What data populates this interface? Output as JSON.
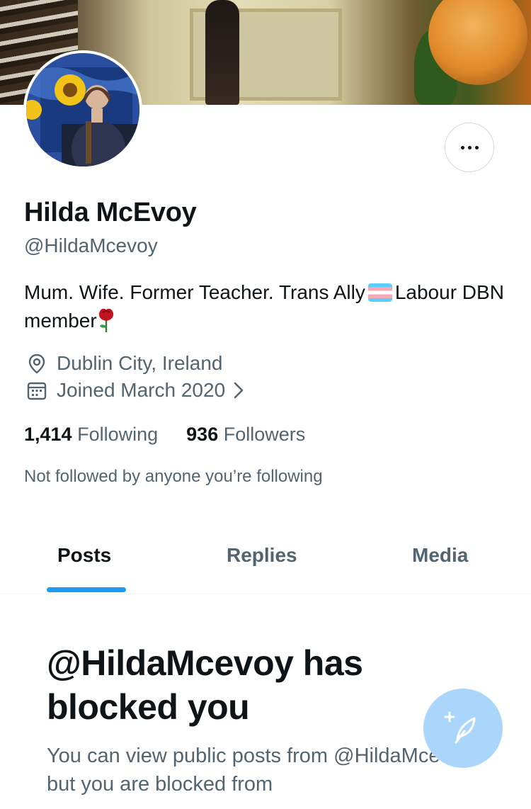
{
  "profile": {
    "display_name": "Hilda McEvoy",
    "handle": "@HildaMcevoy",
    "bio_part1": "Mum. Wife. Former Teacher. Trans Ally",
    "bio_part2": "Labour DBN member",
    "location": "Dublin City, Ireland",
    "joined": "Joined March 2020",
    "following_count": "1,414",
    "following_label": "Following",
    "followers_count": "936",
    "followers_label": "Followers",
    "followed_note": "Not followed by anyone you’re following"
  },
  "tabs": [
    {
      "label": "Posts",
      "active": true
    },
    {
      "label": "Replies",
      "active": false
    },
    {
      "label": "Media",
      "active": false
    }
  ],
  "blocked": {
    "title": "@HildaMcevoy has blocked you",
    "description": "You can view public posts from @HildaMcevoy, but you are blocked from"
  },
  "icons": {
    "more": "more-options-icon",
    "location": "location-pin-icon",
    "calendar": "calendar-icon",
    "chevron": "chevron-right-icon",
    "compose": "compose-post-icon",
    "flag": "transgender-flag-emoji",
    "rose": "rose-emoji"
  },
  "colors": {
    "accent": "#1d9bf0",
    "secondary_text": "#536471",
    "fab": "#a9d6fa"
  }
}
